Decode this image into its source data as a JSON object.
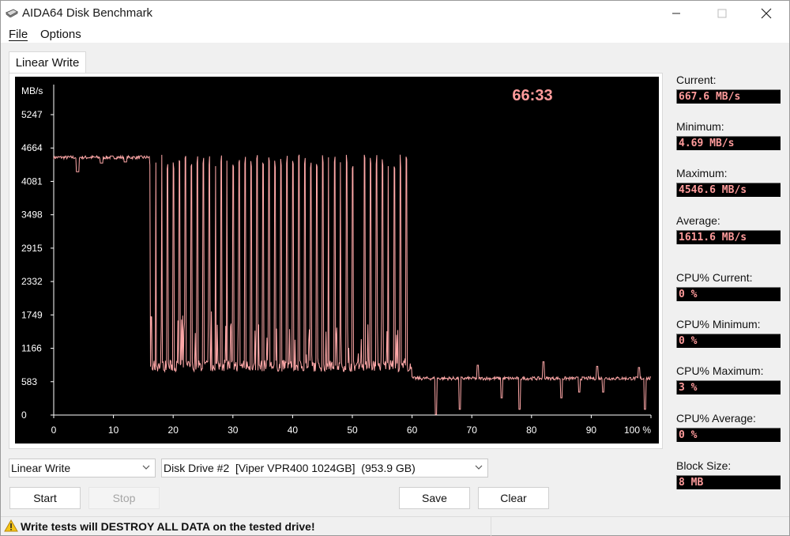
{
  "window": {
    "title": "AIDA64 Disk Benchmark"
  },
  "menu": {
    "file": "File",
    "options": "Options"
  },
  "tab": {
    "label": "Linear Write"
  },
  "stats": {
    "current_label": "Current:",
    "current_value": "667.6 MB/s",
    "minimum_label": "Minimum:",
    "minimum_value": "4.69 MB/s",
    "maximum_label": "Maximum:",
    "maximum_value": "4546.6 MB/s",
    "average_label": "Average:",
    "average_value": "1611.6 MB/s",
    "cpu_current_label": "CPU% Current:",
    "cpu_current_value": "0 %",
    "cpu_minimum_label": "CPU% Minimum:",
    "cpu_minimum_value": "0 %",
    "cpu_maximum_label": "CPU% Maximum:",
    "cpu_maximum_value": "3 %",
    "cpu_average_label": "CPU% Average:",
    "cpu_average_value": "0 %",
    "block_size_label": "Block Size:",
    "block_size_value": "8 MB"
  },
  "controls": {
    "test_select": "Linear Write",
    "drive_select": "Disk Drive #2  [Viper VPR400 1024GB]  (953.9 GB)",
    "start": "Start",
    "stop": "Stop",
    "save": "Save",
    "clear": "Clear"
  },
  "status": {
    "warning": "Write tests will DESTROY ALL DATA on the tested drive!"
  },
  "colors": {
    "trace": "#ffa8a8",
    "timer": "#ff9b9b",
    "value_text": "#ff9b9b",
    "chart_bg": "#000000",
    "axis": "#ffffff"
  },
  "chart_data": {
    "type": "line",
    "timer": "66:33",
    "ylabel": "MB/s",
    "xunit": "%",
    "ylim": [
      0,
      5247
    ],
    "xlim": [
      0,
      100
    ],
    "yticks": [
      "0",
      "583",
      "1166",
      "1749",
      "2332",
      "2915",
      "3498",
      "4081",
      "4664",
      "5247"
    ],
    "xticks": [
      "0",
      "10",
      "20",
      "30",
      "40",
      "50",
      "60",
      "70",
      "80",
      "90",
      "100"
    ],
    "segments": [
      {
        "x_start": 0,
        "x_end": 16,
        "base": 4500,
        "noise": 60,
        "dips": [
          [
            4,
            4250
          ],
          [
            8,
            4400
          ],
          [
            12,
            4420
          ]
        ]
      },
      {
        "x_start": 16,
        "x_end": 60,
        "base": 820,
        "noise": 200,
        "spike_to": 4550,
        "spike_every": 1.0
      },
      {
        "x_start": 60,
        "x_end": 100,
        "base": 640,
        "noise": 60,
        "dips": [
          [
            64,
            10
          ],
          [
            68,
            100
          ],
          [
            71,
            250
          ],
          [
            75,
            300
          ],
          [
            78,
            100
          ],
          [
            82,
            30
          ],
          [
            85,
            300
          ],
          [
            88,
            400
          ],
          [
            92,
            400
          ],
          [
            98,
            300
          ],
          [
            99,
            100
          ]
        ],
        "peaks": [
          [
            71,
            870
          ],
          [
            82,
            930
          ],
          [
            91,
            850
          ],
          [
            98,
            830
          ]
        ]
      }
    ]
  }
}
